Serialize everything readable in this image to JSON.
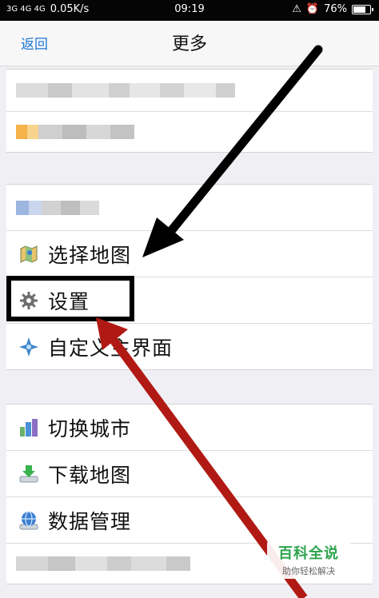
{
  "status_bar": {
    "signal": "3G 4G 4G",
    "speed": "0.05K/s",
    "time": "09:19",
    "battery": "76%",
    "battery_level": 0.76
  },
  "nav": {
    "back_label": "返回",
    "title": "更多"
  },
  "groups": [
    {
      "items": [
        {
          "label": "",
          "icon": "blurred"
        }
      ]
    },
    {
      "items": [
        {
          "label": "选择地图",
          "icon": "map-icon"
        },
        {
          "label": "设置",
          "icon": "gear-icon"
        },
        {
          "label": "自定义主界面",
          "icon": "compass-icon"
        }
      ]
    },
    {
      "items": [
        {
          "label": "切换城市",
          "icon": "city-icon"
        },
        {
          "label": "下载地图",
          "icon": "download-icon"
        },
        {
          "label": "数据管理",
          "icon": "globe-icon"
        }
      ]
    }
  ],
  "annotations": {
    "arrow_black_color": "#000000",
    "arrow_red_color": "#b11a14",
    "highlight_color": "#000000"
  },
  "watermark": {
    "title": "百科全说",
    "subtitle": "助你轻松解决"
  }
}
